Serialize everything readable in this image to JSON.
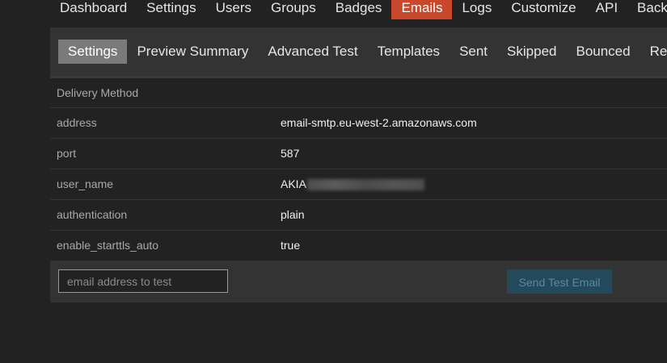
{
  "top_nav": {
    "items": [
      "Dashboard",
      "Settings",
      "Users",
      "Groups",
      "Badges",
      "Emails",
      "Logs",
      "Customize",
      "API",
      "Backups"
    ],
    "active": "Emails"
  },
  "sub_nav": {
    "items": [
      "Settings",
      "Preview Summary",
      "Advanced Test",
      "Templates",
      "Sent",
      "Skipped",
      "Bounced",
      "Received"
    ],
    "active": "Settings"
  },
  "settings": {
    "header": "Delivery Method",
    "rows": [
      {
        "key": "address",
        "value": "email-smtp.eu-west-2.amazonaws.com"
      },
      {
        "key": "port",
        "value": "587"
      },
      {
        "key": "user_name",
        "value": "AKIA"
      },
      {
        "key": "authentication",
        "value": "plain"
      },
      {
        "key": "enable_starttls_auto",
        "value": "true"
      }
    ]
  },
  "test_email": {
    "placeholder": "email address to test",
    "value": "",
    "button_label": "Send Test Email"
  }
}
